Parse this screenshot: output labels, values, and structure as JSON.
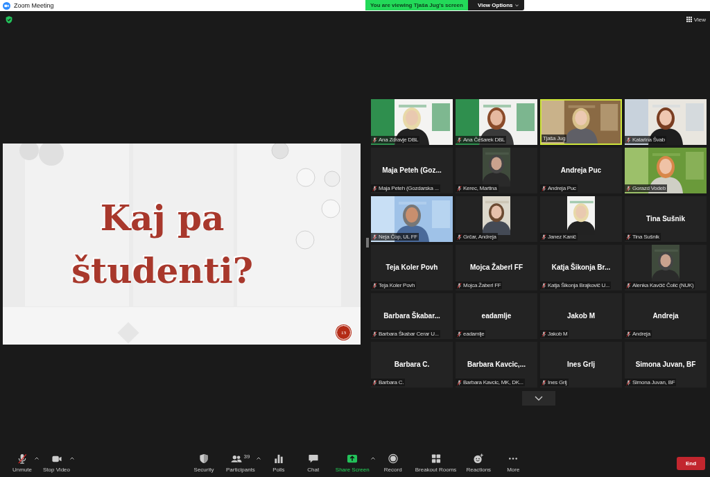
{
  "window": {
    "title": "Zoom Meeting"
  },
  "share_banner": {
    "text": "You are viewing Tjaša Jug's screen",
    "options_button": "View Options"
  },
  "top_bar": {
    "view_button": "View"
  },
  "slide": {
    "lines": [
      "Kaj pa",
      "študenti?"
    ],
    "number": "13"
  },
  "tiles": [
    {
      "kind": "video",
      "label": "Ana Zdravje DBL",
      "muted": true,
      "speaking": false
    },
    {
      "kind": "video",
      "label": "Ana Češarek DBL",
      "muted": true,
      "speaking": false
    },
    {
      "kind": "video",
      "label": "Tjaša Jug",
      "muted": false,
      "speaking": true
    },
    {
      "kind": "video",
      "label": "Katarina Švab",
      "muted": true,
      "speaking": false
    },
    {
      "kind": "name",
      "name": "Maja Peteh (Goz...",
      "label": "Maja Peteh (Gozdarska ...",
      "muted": true,
      "speaking": false
    },
    {
      "label": "Kerec, Martina",
      "muted": true,
      "speaking": false
    },
    {
      "kind": "name",
      "name": "Andreja Puc",
      "label": "Andreja Puc",
      "muted": true,
      "speaking": false
    },
    {
      "kind": "video",
      "label": "Gorazd Vodeb",
      "muted": true,
      "speaking": false
    },
    {
      "kind": "video",
      "label": "Neja Čop, UL FF",
      "muted": true,
      "speaking": false
    },
    {
      "label": "Grčar, Andreja",
      "muted": true,
      "speaking": false
    },
    {
      "label": "Janez Kanič",
      "muted": true,
      "speaking": false
    },
    {
      "kind": "name",
      "name": "Tina Sušnik",
      "label": "Tina Sušnik",
      "muted": true,
      "speaking": false
    },
    {
      "kind": "name",
      "name": "Teja Koler Povh",
      "label": "Teja Koler Povh",
      "muted": true,
      "speaking": false
    },
    {
      "kind": "name",
      "name": "Mojca Žaberl FF",
      "label": "Mojca Žaberl FF",
      "muted": true,
      "speaking": false
    },
    {
      "kind": "name",
      "name": "Katja Šikonja Br...",
      "label": "Katja Šikonja Brajkovič U...",
      "muted": true,
      "speaking": false
    },
    {
      "label": "Alenka Kavčič Čolić (NUK)",
      "muted": true,
      "speaking": false
    },
    {
      "kind": "name",
      "name": "Barbara Škabar...",
      "label": "Barbara Škabar Cerar U...",
      "muted": true,
      "speaking": false
    },
    {
      "kind": "name",
      "name": "eadamlje",
      "label": "eadamlje",
      "muted": true,
      "speaking": false
    },
    {
      "kind": "name",
      "name": "Jakob M",
      "label": "Jakob M",
      "muted": true,
      "speaking": false
    },
    {
      "kind": "name",
      "name": "Andreja",
      "label": "Andreja",
      "muted": true,
      "speaking": false
    },
    {
      "kind": "name",
      "name": "Barbara C.",
      "label": "Barbara C.",
      "muted": true,
      "speaking": false
    },
    {
      "kind": "name",
      "name": "Barbara Kavcic,...",
      "label": "Barbara Kavcic, MK, DK...",
      "muted": true,
      "speaking": false
    },
    {
      "kind": "name",
      "name": "Ines Grlj",
      "label": "Ines Grlj",
      "muted": true,
      "speaking": false
    },
    {
      "kind": "name",
      "name": "Simona Juvan, BF",
      "label": "Simona Juvan, BF",
      "muted": true,
      "speaking": false
    }
  ],
  "toolbar": {
    "left": [
      {
        "label": "Unmute",
        "has_menu": true,
        "highlighted": false
      },
      {
        "label": "Stop Video",
        "has_menu": true,
        "highlighted": false
      }
    ],
    "center": [
      {
        "label": "Security",
        "has_menu": false,
        "highlighted": false
      },
      {
        "label": "Participants",
        "count": "39",
        "has_menu": true,
        "highlighted": false
      },
      {
        "label": "Polls",
        "has_menu": false,
        "highlighted": false
      },
      {
        "label": "Chat",
        "has_menu": false,
        "highlighted": false
      },
      {
        "label": "Share Screen",
        "has_menu": true,
        "highlighted": true
      },
      {
        "label": "Record",
        "has_menu": false,
        "highlighted": false
      },
      {
        "label": "Breakout Rooms",
        "has_menu": false,
        "highlighted": false
      },
      {
        "label": "Reactions",
        "has_menu": false,
        "highlighted": false
      },
      {
        "label": "More",
        "has_menu": false,
        "highlighted": false
      }
    ],
    "end_button": "End"
  }
}
